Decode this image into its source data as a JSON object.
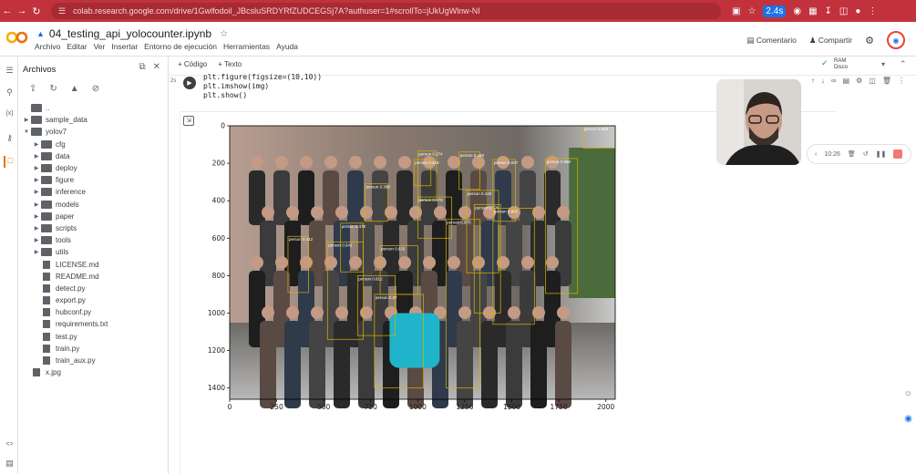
{
  "browser": {
    "url": "colab.research.google.com/drive/1Gwlfodoil_JBcsluSRDYRfZUDCEGSj7A?authuser=1#scrollTo=jUkUgWlnw-NI",
    "ext_badge": "2.4s"
  },
  "header": {
    "title": "04_testing_api_yolocounter.ipynb",
    "menus": [
      "Archivo",
      "Editar",
      "Ver",
      "Insertar",
      "Entorno de ejecución",
      "Herramientas",
      "Ayuda"
    ],
    "comment_label": "Comentario",
    "share_label": "Compartir"
  },
  "files": {
    "title": "Archivos",
    "tree": [
      {
        "name": "..",
        "type": "folder",
        "depth": 0,
        "expanded": false,
        "arrow": false
      },
      {
        "name": "sample_data",
        "type": "folder",
        "depth": 0,
        "expanded": false,
        "arrow": true
      },
      {
        "name": "yolov7",
        "type": "folder",
        "depth": 0,
        "expanded": true,
        "arrow": true
      },
      {
        "name": "cfg",
        "type": "folder",
        "depth": 1,
        "expanded": false,
        "arrow": true
      },
      {
        "name": "data",
        "type": "folder",
        "depth": 1,
        "expanded": false,
        "arrow": true
      },
      {
        "name": "deploy",
        "type": "folder",
        "depth": 1,
        "expanded": false,
        "arrow": true
      },
      {
        "name": "figure",
        "type": "folder",
        "depth": 1,
        "expanded": false,
        "arrow": true
      },
      {
        "name": "inference",
        "type": "folder",
        "depth": 1,
        "expanded": false,
        "arrow": true
      },
      {
        "name": "models",
        "type": "folder",
        "depth": 1,
        "expanded": false,
        "arrow": true
      },
      {
        "name": "paper",
        "type": "folder",
        "depth": 1,
        "expanded": false,
        "arrow": true
      },
      {
        "name": "scripts",
        "type": "folder",
        "depth": 1,
        "expanded": false,
        "arrow": true
      },
      {
        "name": "tools",
        "type": "folder",
        "depth": 1,
        "expanded": false,
        "arrow": true
      },
      {
        "name": "utils",
        "type": "folder",
        "depth": 1,
        "expanded": false,
        "arrow": true
      },
      {
        "name": "LICENSE.md",
        "type": "file",
        "depth": 1
      },
      {
        "name": "README.md",
        "type": "file",
        "depth": 1
      },
      {
        "name": "detect.py",
        "type": "file",
        "depth": 1
      },
      {
        "name": "export.py",
        "type": "file",
        "depth": 1
      },
      {
        "name": "hubconf.py",
        "type": "file",
        "depth": 1
      },
      {
        "name": "requirements.txt",
        "type": "file",
        "depth": 1
      },
      {
        "name": "test.py",
        "type": "file",
        "depth": 1
      },
      {
        "name": "train.py",
        "type": "file",
        "depth": 1
      },
      {
        "name": "train_aux.py",
        "type": "file",
        "depth": 1
      },
      {
        "name": "x.jpg",
        "type": "file",
        "depth": 0
      }
    ]
  },
  "toolbar": {
    "code_label": "+ Código",
    "text_label": "+ Texto",
    "ram_label": "RAM",
    "disk_label": "Disco"
  },
  "cell": {
    "exec_count": "2s",
    "code_lines": [
      "plt.figure(figsize=(10,10))",
      "plt.imshow(img)",
      "plt.show()"
    ]
  },
  "recorder": {
    "time": "10:26"
  },
  "plot": {
    "x_ticks": [
      "0",
      "250",
      "500",
      "750",
      "1000",
      "1250",
      "1500",
      "1750",
      "2000"
    ],
    "y_ticks": [
      "0",
      "200",
      "400",
      "600",
      "800",
      "1000",
      "1200",
      "1400"
    ],
    "detections": [
      {
        "label": "person 0.448",
        "x": 1220,
        "y": 140,
        "w": 110,
        "h": 200
      },
      {
        "label": "person 0.274",
        "x": 1000,
        "y": 135,
        "w": 100,
        "h": 260
      },
      {
        "label": "person 0.837",
        "x": 1400,
        "y": 180,
        "w": 120,
        "h": 330
      },
      {
        "label": "person 0.858",
        "x": 1680,
        "y": 175,
        "w": 170,
        "h": 720
      },
      {
        "label": "person 0.678",
        "x": 1000,
        "y": 380,
        "w": 180,
        "h": 220
      },
      {
        "label": "person 0.433",
        "x": 1260,
        "y": 345,
        "w": 170,
        "h": 440
      },
      {
        "label": "person 0.776",
        "x": 1300,
        "y": 420,
        "w": 140,
        "h": 580
      },
      {
        "label": "person 0.870",
        "x": 1150,
        "y": 500,
        "w": 180,
        "h": 900
      },
      {
        "label": "person 0.903",
        "x": 1400,
        "y": 440,
        "w": 220,
        "h": 620
      },
      {
        "label": "person 0.478",
        "x": 590,
        "y": 520,
        "w": 120,
        "h": 260
      },
      {
        "label": "person 0.812",
        "x": 680,
        "y": 800,
        "w": 200,
        "h": 320
      },
      {
        "label": "person 0.87",
        "x": 770,
        "y": 900,
        "w": 260,
        "h": 500
      },
      {
        "label": "person 0.412",
        "x": 310,
        "y": 590,
        "w": 110,
        "h": 300
      },
      {
        "label": "person 0.625",
        "x": 800,
        "y": 640,
        "w": 200,
        "h": 260
      },
      {
        "label": "person 0.541",
        "x": 520,
        "y": 620,
        "w": 190,
        "h": 520
      },
      {
        "label": "person 0.418",
        "x": 980,
        "y": 180,
        "w": 90,
        "h": 140
      },
      {
        "label": "person 0.388",
        "x": 720,
        "y": 310,
        "w": 120,
        "h": 200
      },
      {
        "label": "person 0.888",
        "x": 1880,
        "y": 0,
        "w": 170,
        "h": 120
      }
    ]
  }
}
